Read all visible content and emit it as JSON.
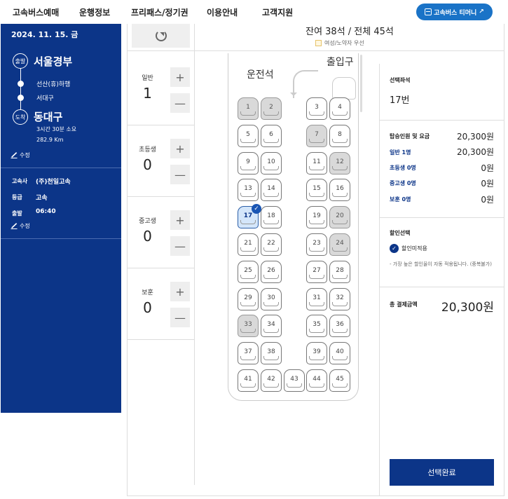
{
  "nav": {
    "items": [
      "고속버스예매",
      "운행정보",
      "프리패스/정기권",
      "이용안내",
      "고객지원"
    ],
    "tmoney": "고속버스 티머니"
  },
  "sidebar": {
    "date": "2024. 11. 15. 금",
    "depart_badge": "출발",
    "depart_city": "서울경부",
    "stops": [
      "선산(휴)하행",
      "서대구"
    ],
    "arrive_badge": "도착",
    "arrive_city": "동대구",
    "duration": "3시간 30분 소요",
    "distance": "282.9 Km",
    "edit": "수정",
    "company_label": "고속사",
    "company": "(주)천일고속",
    "grade_label": "등급",
    "grade": "고속",
    "time_label": "출발",
    "time": "06:40",
    "edit2": "수정"
  },
  "seat_header": {
    "remain": "잔여 38석 / 전체 45석",
    "legend": "여성/노약자 우선"
  },
  "passengers": [
    {
      "label": "일반",
      "count": "1"
    },
    {
      "label": "초등생",
      "count": "0"
    },
    {
      "label": "중고생",
      "count": "0"
    },
    {
      "label": "보훈",
      "count": "0"
    }
  ],
  "bus": {
    "driver": "운전석",
    "entrance": "출입구",
    "taken": [
      "1",
      "2",
      "7",
      "12",
      "20",
      "24",
      "33"
    ],
    "selected": "17",
    "seats": [
      "1",
      "2",
      "3",
      "4",
      "5",
      "6",
      "7",
      "8",
      "9",
      "10",
      "11",
      "12",
      "13",
      "14",
      "15",
      "16",
      "17",
      "18",
      "19",
      "20",
      "21",
      "22",
      "23",
      "24",
      "25",
      "26",
      "27",
      "28",
      "29",
      "30",
      "31",
      "32",
      "33",
      "34",
      "35",
      "36",
      "37",
      "38",
      "39",
      "40",
      "41",
      "42",
      "43",
      "44",
      "45"
    ]
  },
  "summary": {
    "selected_title": "선택좌석",
    "selected_value": "17번",
    "fare_label": "탑승인원 및 요금",
    "fare_value": "20,300원",
    "rows": [
      {
        "label": "일반 1명",
        "value": "20,300원"
      },
      {
        "label": "초등생 0명",
        "value": "0원"
      },
      {
        "label": "중고생 0명",
        "value": "0원"
      },
      {
        "label": "보훈 0명",
        "value": "0원"
      }
    ],
    "discount_title": "할인선택",
    "discount_option": "할인미적용",
    "discount_note": "- 가장 높은 할인율이 자동 적용됩니다. (중복불가)",
    "total_label": "총 결제금액",
    "total_value": "20,300원",
    "confirm": "선택완료"
  }
}
